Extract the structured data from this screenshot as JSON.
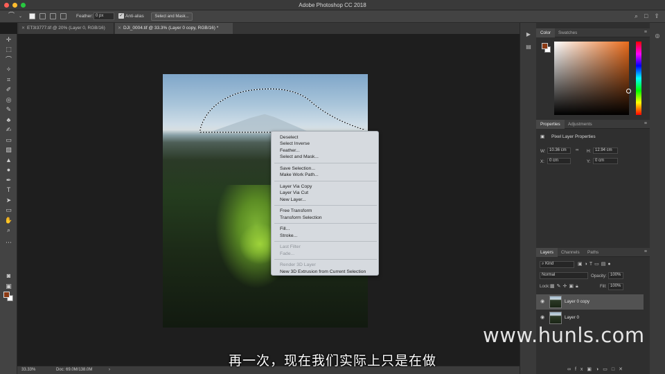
{
  "app": {
    "title": "Adobe Photoshop CC 2018"
  },
  "options_bar": {
    "feather_label": "Feather:",
    "feather_value": "0 px",
    "antialias_label": "Anti-alias",
    "select_and_mask": "Select and Mask..."
  },
  "tabs": [
    {
      "label": "ET3I3777.tif @ 20% (Layer 0, RGB/16)"
    },
    {
      "label": "DJI_0004.tif @ 33.3% (Layer 0 copy, RGB/16) *"
    }
  ],
  "context_menu": {
    "items": [
      {
        "label": "Deselect",
        "enabled": true
      },
      {
        "label": "Select Inverse",
        "enabled": true
      },
      {
        "label": "Feather...",
        "enabled": true
      },
      {
        "label": "Select and Mask...",
        "enabled": true
      },
      {
        "label": "Save Selection...",
        "enabled": true
      },
      {
        "label": "Make Work Path...",
        "enabled": true
      },
      {
        "label": "Layer Via Copy",
        "enabled": true
      },
      {
        "label": "Layer Via Cut",
        "enabled": true
      },
      {
        "label": "New Layer...",
        "enabled": true
      },
      {
        "label": "Free Transform",
        "enabled": true
      },
      {
        "label": "Transform Selection",
        "enabled": true
      },
      {
        "label": "Fill...",
        "enabled": true
      },
      {
        "label": "Stroke...",
        "enabled": true
      },
      {
        "label": "Last Filter",
        "enabled": false
      },
      {
        "label": "Fade...",
        "enabled": false
      },
      {
        "label": "Render 3D Layer",
        "enabled": false
      },
      {
        "label": "New 3D Extrusion from Current Selection",
        "enabled": true
      }
    ]
  },
  "color_panel": {
    "tabs": [
      "Color",
      "Swatches"
    ],
    "foreground": "#8b3a14",
    "background": "#ffffff"
  },
  "properties_panel": {
    "tabs": [
      "Properties",
      "Adjustments"
    ],
    "title": "Pixel Layer Properties",
    "w_label": "W:",
    "w_value": "10.36 cm",
    "h_label": "H:",
    "h_value": "12.94 cm",
    "x_label": "X:",
    "x_value": "0 cm",
    "y_label": "Y:",
    "y_value": "0 cm"
  },
  "layers_panel": {
    "tabs": [
      "Layers",
      "Channels",
      "Paths"
    ],
    "filter_label": "Kind",
    "blend_mode": "Normal",
    "opacity_label": "Opacity:",
    "opacity_value": "100%",
    "lock_label": "Lock:",
    "fill_label": "Fill:",
    "fill_value": "100%",
    "layers": [
      {
        "name": "Layer 0 copy",
        "selected": true
      },
      {
        "name": "Layer 0",
        "selected": false
      }
    ]
  },
  "status_bar": {
    "zoom": "33.33%",
    "doc": "Doc: 69.0M/138.0M"
  },
  "overlay": {
    "subtitle": "再一次，现在我们实际上只是在做",
    "watermark": "www.hunls.com"
  }
}
